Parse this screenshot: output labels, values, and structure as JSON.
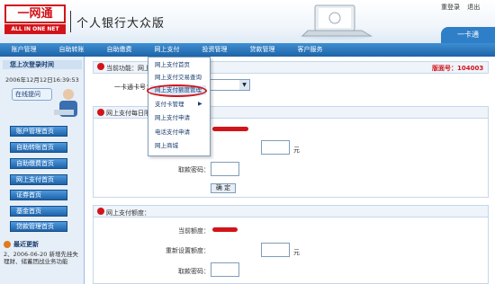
{
  "header": {
    "logo_cn": "一网通",
    "logo_en": "ALL IN ONE NET",
    "bank_title": "个人银行大众版",
    "top_links": [
      "重登录",
      "退出"
    ],
    "card_tab": "一卡通"
  },
  "nav": {
    "items": [
      "账户管理",
      "自助转账",
      "自助缴费",
      "网上支付",
      "投资管理",
      "贷款管理",
      "客户服务"
    ]
  },
  "sidebar": {
    "login_time_heading": "您上次登录时间",
    "login_time": "2006年12月12日16:39:53",
    "online_help": "在线提问",
    "menu": [
      "账户管理首页",
      "自助转账首页",
      "自助缴费首页",
      "网上支付首页",
      "证券首页",
      "基金首页",
      "贷款管理首页"
    ],
    "news_heading": "最近更新",
    "news_item": "2、2006-06-20 新增先挂失理财、储蓄团战业务功能"
  },
  "main": {
    "crumb_label": "当前功能：网上",
    "page_code": "版面号：104003",
    "card_label": "一卡通卡号：",
    "section1_title": "网上支付每日限额",
    "section1_unit": "元",
    "section1_pwd_label": "取款密码：",
    "confirm": "确 定",
    "section2_title": "网上支付额度：",
    "current_limit_label": "当前额度：",
    "reset_limit_label": "重新设置额度：",
    "section2_unit": "元",
    "section2_pwd_label": "取款密码："
  },
  "dropdown": {
    "items": [
      "网上支付首页",
      "网上支付交易查询",
      "网上支付额度管理",
      "支付卡管理",
      "网上支付申请",
      "电话支付申请",
      "网上商城"
    ],
    "highlighted_index": 2
  }
}
